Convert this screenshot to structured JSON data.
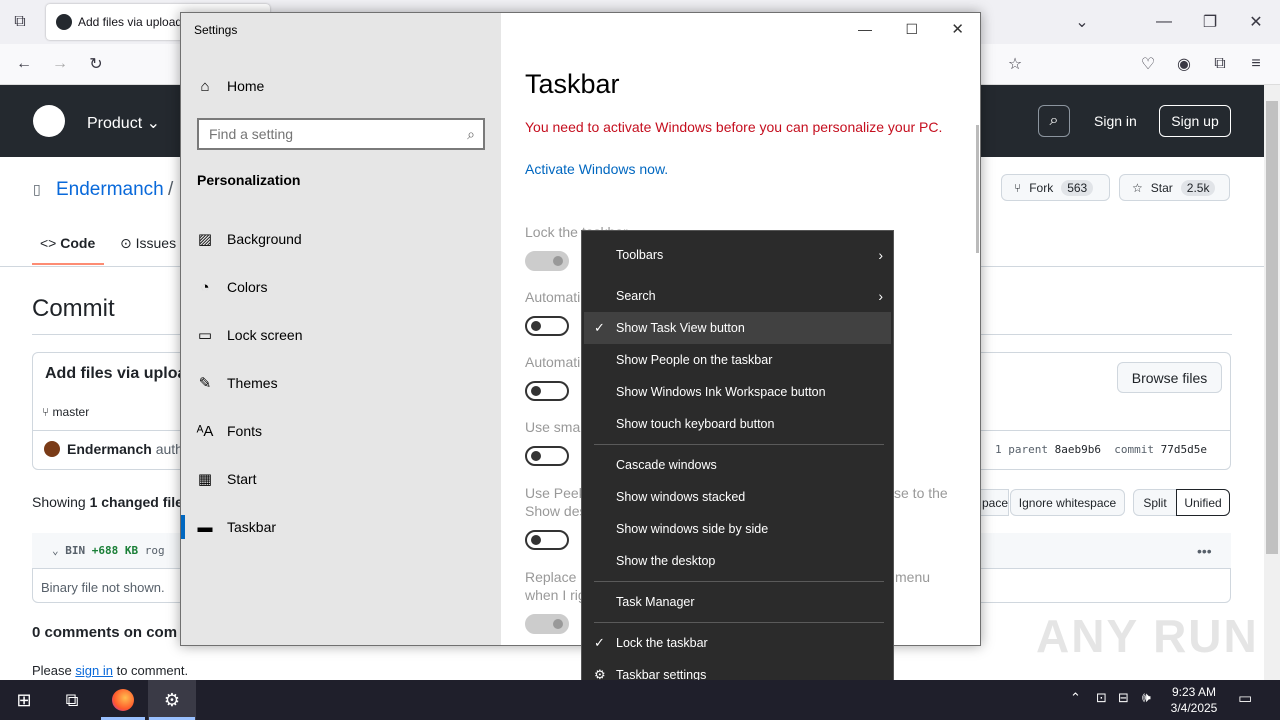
{
  "browser": {
    "tab_title": "Add files via upload",
    "tab_icon": "github-icon"
  },
  "github": {
    "nav_product": "Product",
    "sign_in": "Sign in",
    "sign_up": "Sign up",
    "repo_owner": "Endermanch",
    "repo_sep": "/",
    "fork_label": "Fork",
    "fork_count": "563",
    "star_label": "Star",
    "star_count": "2.5k",
    "tab_code": "Code",
    "tab_issues": "Issues",
    "commit_heading": "Commit",
    "commit_title": "Add files via uploa",
    "browse_files": "Browse files",
    "branch": "master",
    "author": "Endermanch",
    "author_suffix": "autho",
    "parent_label": "1 parent",
    "parent_hash": "8aeb9b6",
    "commit_label": "commit",
    "commit_hash": "77d5d5e",
    "showing_prefix": "Showing",
    "showing_bold": "1 changed file",
    "whitespace_partial": "pace",
    "ignore_whitespace": "Ignore whitespace",
    "split": "Split",
    "unified": "Unified",
    "file_bin": "BIN",
    "file_size": "+688 KB",
    "file_name": "rog",
    "binary_note": "Binary file not shown.",
    "comments": "0 comments on com",
    "please": "Please",
    "sign_in_link": "sign in",
    "to_comment": "to comment."
  },
  "settings": {
    "window_title": "Settings",
    "home": "Home",
    "search_placeholder": "Find a setting",
    "section": "Personalization",
    "nav": [
      {
        "label": "Background",
        "icon": "picture-icon"
      },
      {
        "label": "Colors",
        "icon": "palette-icon"
      },
      {
        "label": "Lock screen",
        "icon": "lock-screen-icon"
      },
      {
        "label": "Themes",
        "icon": "brush-icon"
      },
      {
        "label": "Fonts",
        "icon": "font-icon"
      },
      {
        "label": "Start",
        "icon": "start-icon"
      },
      {
        "label": "Taskbar",
        "icon": "taskbar-icon"
      }
    ],
    "page_title": "Taskbar",
    "activation_warning": "You need to activate Windows before you can personalize your PC.",
    "activate_link": "Activate Windows now.",
    "lock_taskbar": "Lock the taskbar",
    "auto_hide_1": "Automati",
    "auto_hide_2": "Automati",
    "use_small": "Use small",
    "use_peek_1": "Use Peek",
    "use_peek_2": "Show des",
    "use_peek_tail": "se to the",
    "replace_1": "Replace C",
    "replace_2": "when I rig",
    "replace_tail": "menu"
  },
  "context_menu": {
    "items": [
      {
        "label": "Toolbars",
        "check": "",
        "arrow": "›"
      },
      {
        "label": "Search",
        "check": "",
        "arrow": "›"
      },
      {
        "label": "Show Task View button",
        "check": "✓",
        "arrow": ""
      },
      {
        "label": "Show People on the taskbar",
        "check": "",
        "arrow": ""
      },
      {
        "label": "Show Windows Ink Workspace button",
        "check": "",
        "arrow": ""
      },
      {
        "label": "Show touch keyboard button",
        "check": "",
        "arrow": ""
      },
      {
        "label": "Cascade windows",
        "check": "",
        "arrow": ""
      },
      {
        "label": "Show windows stacked",
        "check": "",
        "arrow": ""
      },
      {
        "label": "Show windows side by side",
        "check": "",
        "arrow": ""
      },
      {
        "label": "Show the desktop",
        "check": "",
        "arrow": ""
      },
      {
        "label": "Task Manager",
        "check": "",
        "arrow": ""
      },
      {
        "label": "Lock the taskbar",
        "check": "✓",
        "arrow": ""
      },
      {
        "label": "Taskbar settings",
        "check": "⚙",
        "arrow": ""
      }
    ]
  },
  "taskbar": {
    "time": "9:23 AM",
    "date": "3/4/2025"
  },
  "watermark": "ANY RUN",
  "colors": {
    "accent_link": "#0067c0",
    "warning": "#c50f1f",
    "gh_header": "#24292f"
  }
}
